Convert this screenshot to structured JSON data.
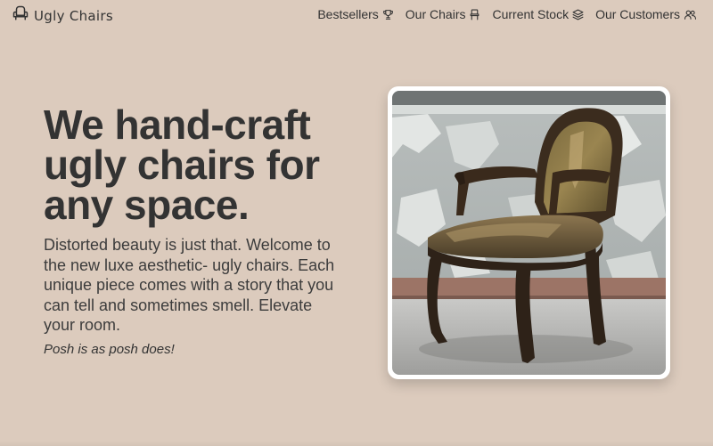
{
  "brand": {
    "name": "Ugly Chairs",
    "icon": "armchair-icon"
  },
  "nav": {
    "items": [
      {
        "label": "Bestsellers",
        "icon": "trophy-icon"
      },
      {
        "label": "Our Chairs",
        "icon": "chair-icon"
      },
      {
        "label": "Current Stock",
        "icon": "layers-icon"
      },
      {
        "label": "Our Customers",
        "icon": "users-icon"
      }
    ]
  },
  "hero": {
    "title": "We hand-craft ugly chairs for any space.",
    "body": "Distorted beauty is just that. Welcome to the new luxe aesthetic- ugly chairs. Each unique piece comes with a story that you can tell and sometimes smell. Elevate your room.",
    "tagline": "Posh is as posh does!"
  },
  "colors": {
    "background": "#dccbbd",
    "text": "#333333",
    "card": "#ffffff"
  }
}
